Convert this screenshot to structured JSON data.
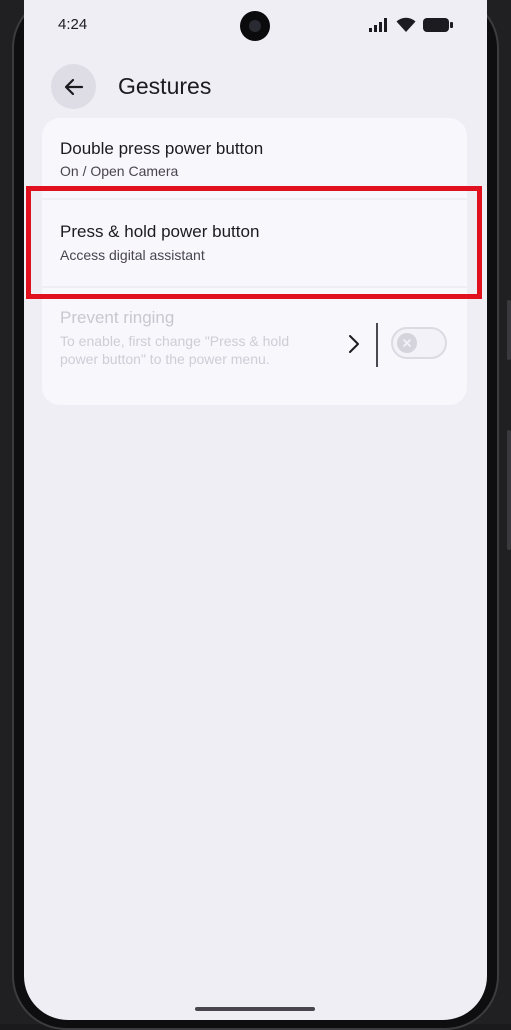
{
  "status_bar": {
    "time": "4:24",
    "icons": [
      "signal-icon",
      "wifi-icon",
      "battery-icon"
    ]
  },
  "header": {
    "back_icon": "arrow-left-icon",
    "title": "Gestures"
  },
  "settings": [
    {
      "title": "Double press power button",
      "subtitle": "On / Open Camera",
      "enabled": true
    },
    {
      "title": "Press & hold power button",
      "subtitle": "Access digital assistant",
      "enabled": true,
      "highlighted": true
    },
    {
      "title": "Prevent ringing",
      "subtitle": "To enable, first change \"Press & hold power button\" to the power menu.",
      "enabled": false,
      "toggle_on": false
    }
  ],
  "colors": {
    "background": "#efeef5",
    "card": "#f8f7fc",
    "highlight": "#e0101e",
    "text": "#1c1b1f"
  }
}
